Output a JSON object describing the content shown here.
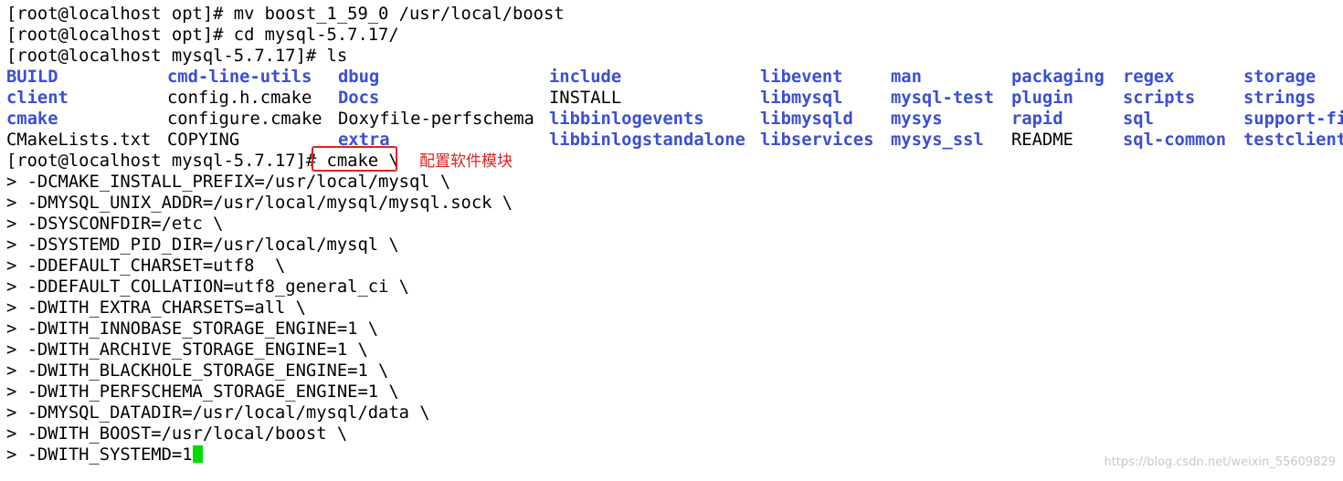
{
  "terminal": {
    "commands": [
      "[root@localhost opt]# mv boost_1_59_0 /usr/local/boost",
      "[root@localhost opt]# cd mysql-5.7.17/",
      "[root@localhost mysql-5.7.17]# ls"
    ],
    "ls_rows": [
      [
        {
          "text": "BUILD",
          "dir": true
        },
        {
          "text": "cmd-line-utils",
          "dir": true
        },
        {
          "text": "dbug",
          "dir": true
        },
        {
          "text": "include",
          "dir": true
        },
        {
          "text": "libevent",
          "dir": true
        },
        {
          "text": "man",
          "dir": true
        },
        {
          "text": "packaging",
          "dir": true
        },
        {
          "text": "regex",
          "dir": true
        },
        {
          "text": "storage",
          "dir": true
        }
      ],
      [
        {
          "text": "client",
          "dir": true
        },
        {
          "text": "config.h.cmake",
          "dir": false
        },
        {
          "text": "Docs",
          "dir": true
        },
        {
          "text": "INSTALL",
          "dir": false
        },
        {
          "text": "libmysql",
          "dir": true
        },
        {
          "text": "mysql-test",
          "dir": true
        },
        {
          "text": "plugin",
          "dir": true
        },
        {
          "text": "scripts",
          "dir": true
        },
        {
          "text": "strings",
          "dir": true
        }
      ],
      [
        {
          "text": "cmake",
          "dir": true
        },
        {
          "text": "configure.cmake",
          "dir": false
        },
        {
          "text": "Doxyfile-perfschema",
          "dir": false
        },
        {
          "text": "libbinlogevents",
          "dir": true
        },
        {
          "text": "libmysqld",
          "dir": true
        },
        {
          "text": "mysys",
          "dir": true
        },
        {
          "text": "rapid",
          "dir": true
        },
        {
          "text": "sql",
          "dir": true
        },
        {
          "text": "support-fi",
          "dir": true
        }
      ],
      [
        {
          "text": "CMakeLists.txt",
          "dir": false
        },
        {
          "text": "COPYING",
          "dir": false
        },
        {
          "text": "extra",
          "dir": true
        },
        {
          "text": "libbinlogstandalone",
          "dir": true
        },
        {
          "text": "libservices",
          "dir": true
        },
        {
          "text": "mysys_ssl",
          "dir": true
        },
        {
          "text": "README",
          "dir": false
        },
        {
          "text": "sql-common",
          "dir": true
        },
        {
          "text": "testclient",
          "dir": true
        }
      ]
    ],
    "cmake_prompt": "[root@localhost mysql-5.7.17]#",
    "cmake_command": " cmake \\",
    "continuation_lines": [
      "> -DCMAKE_INSTALL_PREFIX=/usr/local/mysql \\",
      "> -DMYSQL_UNIX_ADDR=/usr/local/mysql/mysql.sock \\",
      "> -DSYSCONFDIR=/etc \\",
      "> -DSYSTEMD_PID_DIR=/usr/local/mysql \\",
      "> -DDEFAULT_CHARSET=utf8  \\",
      "> -DDEFAULT_COLLATION=utf8_general_ci \\",
      "> -DWITH_EXTRA_CHARSETS=all \\",
      "> -DWITH_INNOBASE_STORAGE_ENGINE=1 \\",
      "> -DWITH_ARCHIVE_STORAGE_ENGINE=1 \\",
      "> -DWITH_BLACKHOLE_STORAGE_ENGINE=1 \\",
      "> -DWITH_PERFSCHEMA_STORAGE_ENGINE=1 \\",
      "> -DMYSQL_DATADIR=/usr/local/mysql/data \\",
      "> -DWITH_BOOST=/usr/local/boost \\"
    ],
    "last_line": "> -DWITH_SYSTEMD=1"
  },
  "annotation": {
    "text": "配置软件模块",
    "color": "#e02020"
  },
  "watermark": "https://blog.csdn.net/weixin_55609829",
  "colors": {
    "background": "#ffffff",
    "text": "#000000",
    "directory": "#3b4fd6",
    "cursor": "#00dd00",
    "highlight": "#e02020"
  }
}
